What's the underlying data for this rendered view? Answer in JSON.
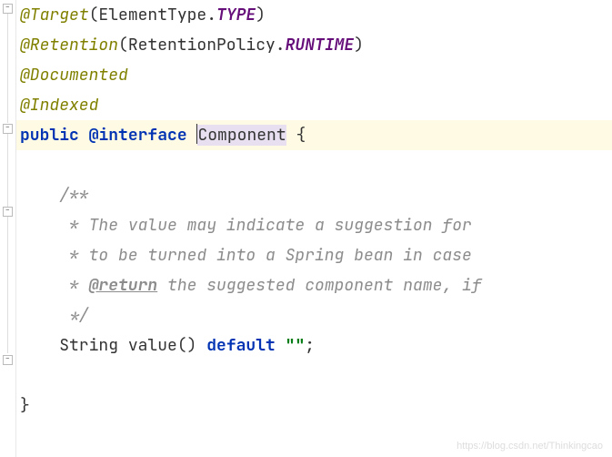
{
  "lines": {
    "l1": {
      "annotation": "@Target",
      "openParen": "(",
      "typeRef": "ElementType.",
      "constant": "TYPE",
      "closeParen": ")"
    },
    "l2": {
      "annotation": "@Retention",
      "openParen": "(",
      "typeRef": "RetentionPolicy.",
      "constant": "RUNTIME",
      "closeParen": ")"
    },
    "l3": {
      "annotation": "@Documented"
    },
    "l4": {
      "annotation": "@Indexed"
    },
    "l5": {
      "keyword1": "public",
      "space1": " ",
      "at": "@",
      "keyword2": "interface",
      "space2": " ",
      "className": "Component",
      "space3": " ",
      "brace": "{"
    },
    "l7": {
      "indent": "    ",
      "comment": "/**"
    },
    "l8": {
      "indent": "     ",
      "comment": "* The value may indicate a suggestion for"
    },
    "l9": {
      "indent": "     ",
      "comment": "* to be turned into a Spring bean in case"
    },
    "l10": {
      "indent": "     ",
      "starPrefix": "* ",
      "docTag": "@return",
      "commentRest": " the suggested component name, if"
    },
    "l11": {
      "indent": "     ",
      "comment": "*/"
    },
    "l12": {
      "indent": "    ",
      "typeRef": "String ",
      "method": "value() ",
      "keyword": "default",
      "space": " ",
      "string": "\"\"",
      "semicolon": ";"
    },
    "l14": {
      "brace": "}"
    }
  },
  "watermark": "https://blog.csdn.net/Thinkingcao"
}
